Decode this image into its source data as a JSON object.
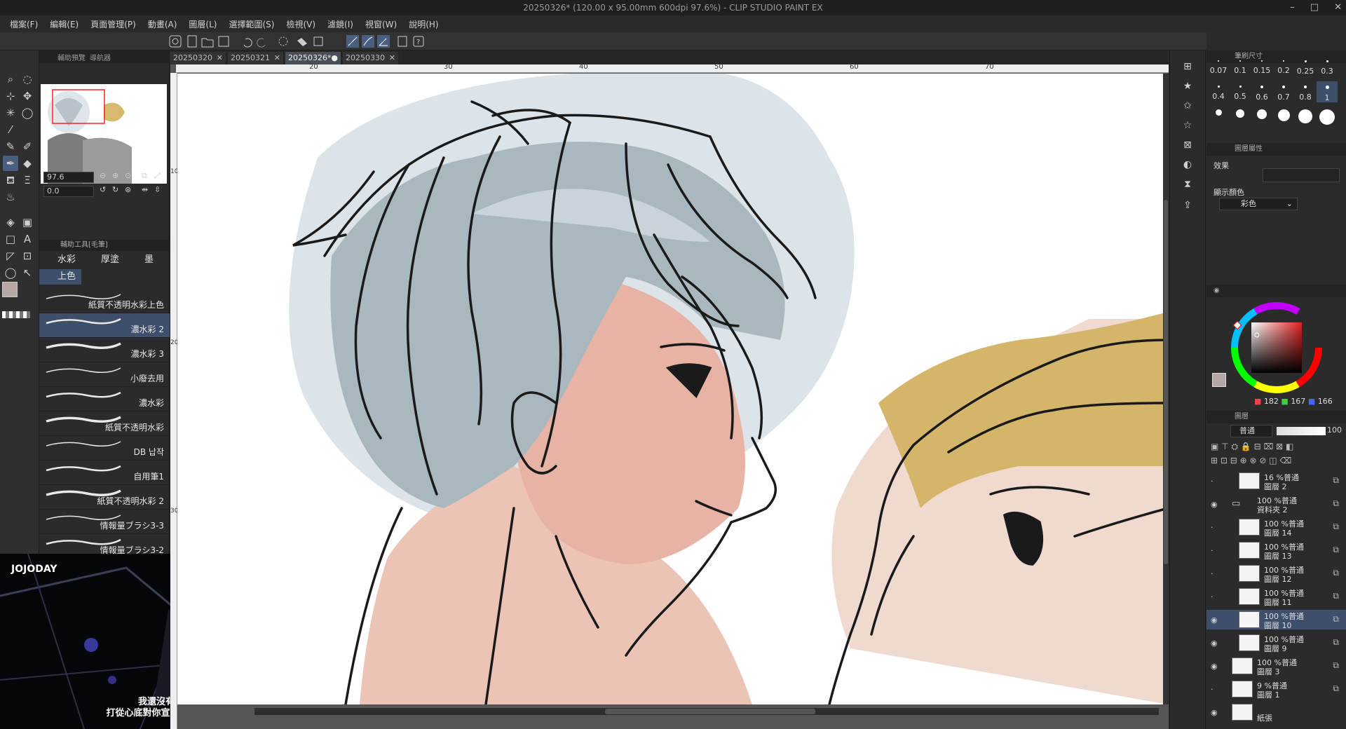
{
  "window": {
    "title": "20250326* (120.00 x 95.00mm 600dpi 97.6%) - CLIP STUDIO PAINT EX"
  },
  "menu": [
    "檔案(F)",
    "編輯(E)",
    "頁面管理(P)",
    "動畫(A)",
    "圖層(L)",
    "選擇範圍(S)",
    "檢視(V)",
    "濾鏡(I)",
    "視窗(W)",
    "說明(H)"
  ],
  "navigator": {
    "tabs": [
      "輔助預覽",
      "導航器"
    ],
    "zoom": "97.6",
    "rotation": "0.0"
  },
  "subtool": {
    "header": "輔助工具[毛筆]",
    "groups": [
      "水彩",
      "厚塗",
      "墨"
    ],
    "selected_group": "上色"
  },
  "brushes": [
    {
      "name": "紙質不透明水彩上色",
      "selected": false
    },
    {
      "name": "濃水彩 2",
      "selected": true
    },
    {
      "name": "濃水彩 3",
      "selected": false
    },
    {
      "name": "小廢去用",
      "selected": false
    },
    {
      "name": "濃水彩",
      "selected": false
    },
    {
      "name": "紙質不透明水彩",
      "selected": false
    },
    {
      "name": "DB 납작",
      "selected": false
    },
    {
      "name": "自用筆1",
      "selected": false
    },
    {
      "name": "紙質不透明水彩 2",
      "selected": false
    },
    {
      "name": "情報量ブラシ3-3",
      "selected": false
    },
    {
      "name": "情報量ブラシ3-2",
      "selected": false
    }
  ],
  "video": {
    "logo": "JOJODAY",
    "subtitle_line1": "我還沒有",
    "subtitle_line2": "打從心底對你宣誓效忠呢"
  },
  "doc_tabs": [
    {
      "name": "20250320",
      "active": false
    },
    {
      "name": "20250321",
      "active": false
    },
    {
      "name": "20250326*",
      "active": true
    },
    {
      "name": "20250330",
      "active": false
    }
  ],
  "ruler": {
    "h_labels": [
      "20",
      "30",
      "40",
      "50",
      "60",
      "70"
    ],
    "v_labels": [
      "10",
      "20",
      "30"
    ]
  },
  "brush_size": {
    "header": "筆刷尺寸",
    "sizes": [
      "0.07",
      "0.1",
      "0.15",
      "0.2",
      "0.25",
      "0.3",
      "0.4",
      "0.5",
      "0.6",
      "0.7",
      "0.8",
      "1"
    ],
    "selected": "1"
  },
  "layer_property": {
    "header": "圖層屬性",
    "effect_label": "效果",
    "display_color_label": "顯示顏色",
    "display_color_value": "彩色"
  },
  "color": {
    "main": "#b6a7a6",
    "r": "182",
    "g": "167",
    "b": "166"
  },
  "layer_panel": {
    "header": "圖層",
    "blend_mode": "普通",
    "opacity": "100"
  },
  "layers": [
    {
      "l1": "16 %普通",
      "l2": "圖層 2",
      "visible": false,
      "selected": false,
      "indent": true
    },
    {
      "l1": "100 %普通",
      "l2": "資料夾 2",
      "visible": true,
      "selected": false,
      "folder": true
    },
    {
      "l1": "100 %普通",
      "l2": "圖層 14",
      "visible": false,
      "selected": false,
      "indent": true
    },
    {
      "l1": "100 %普通",
      "l2": "圖層 13",
      "visible": false,
      "selected": false,
      "indent": true
    },
    {
      "l1": "100 %普通",
      "l2": "圖層 12",
      "visible": false,
      "selected": false,
      "indent": true
    },
    {
      "l1": "100 %普通",
      "l2": "圖層 11",
      "visible": false,
      "selected": false,
      "indent": true
    },
    {
      "l1": "100 %普通",
      "l2": "圖層 10",
      "visible": true,
      "selected": true,
      "indent": true
    },
    {
      "l1": "100 %普通",
      "l2": "圖層 9",
      "visible": true,
      "selected": false,
      "indent": true
    },
    {
      "l1": "100 %普通",
      "l2": "圖層 3",
      "visible": true,
      "selected": false
    },
    {
      "l1": "9 %普通",
      "l2": "圖層 1",
      "visible": false,
      "selected": false
    },
    {
      "l1": "",
      "l2": "紙張",
      "visible": true,
      "selected": false,
      "paper": true
    }
  ]
}
